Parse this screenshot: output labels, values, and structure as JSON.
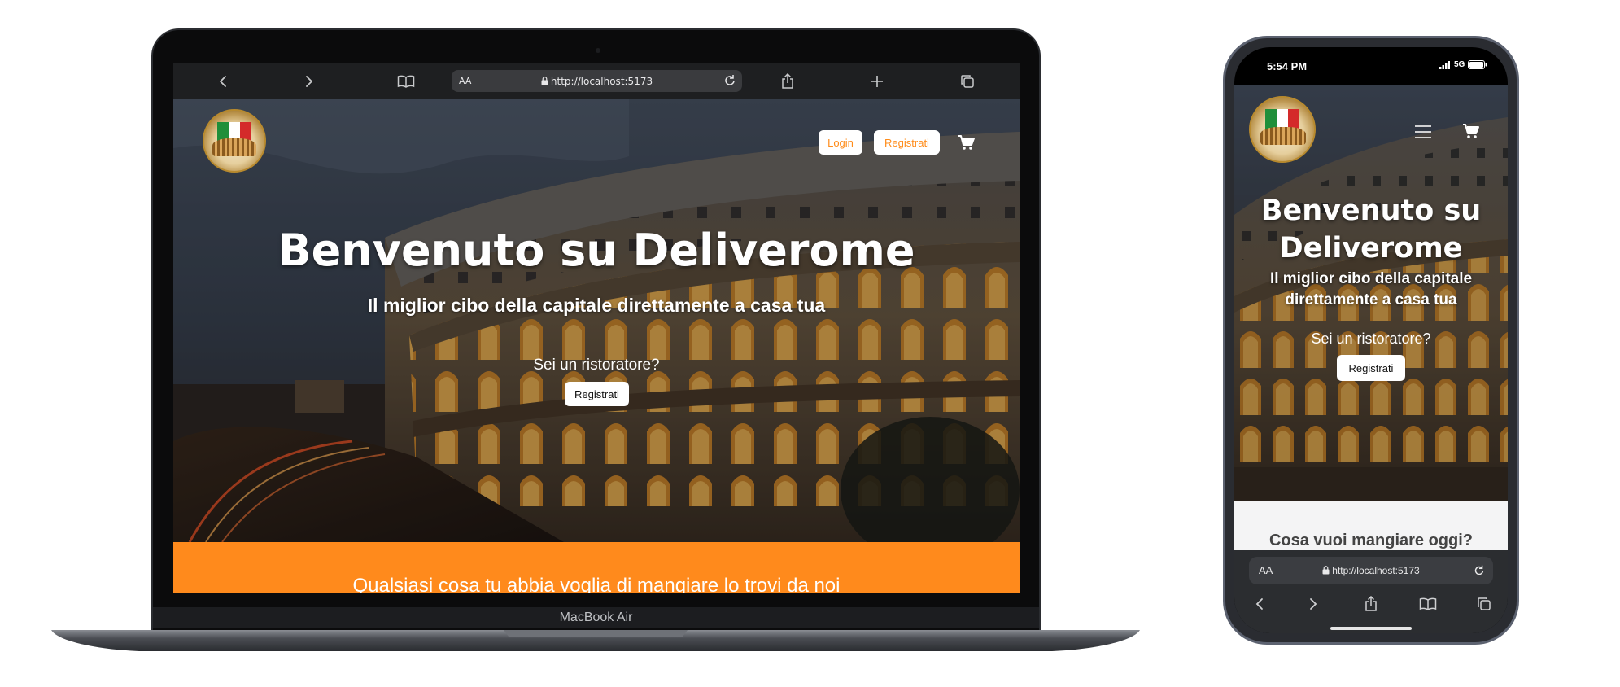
{
  "laptop": {
    "browser": {
      "url": "http://localhost:5173",
      "text_size_label": "AA"
    },
    "header": {
      "login_label": "Login",
      "register_label": "Registrati"
    },
    "hero": {
      "title": "Benvenuto su Deliverome",
      "subtitle": "Il miglior cibo della capitale direttamente a casa tua",
      "restaurateur_question": "Sei un ristoratore?",
      "restaurateur_button": "Registrati"
    },
    "band": {
      "text": "Qualsiasi cosa tu abbia voglia di mangiare lo trovi da noi"
    },
    "model_label": "MacBook Air"
  },
  "phone": {
    "status": {
      "time": "5:54 PM",
      "network": "5G"
    },
    "hero": {
      "title_line1": "Benvenuto su",
      "title_line2": "Deliverome",
      "subtitle_line1": "Il miglior cibo della capitale",
      "subtitle_line2": "direttamente a casa tua",
      "restaurateur_question": "Sei un ristoratore?",
      "restaurateur_button": "Registrati"
    },
    "section": {
      "heading": "Cosa vuoi mangiare oggi?"
    },
    "browser": {
      "url": "http://localhost:5173",
      "text_size_label": "AA"
    }
  },
  "colors": {
    "accent_orange": "#ff8a1c",
    "button_bg": "#ffffff",
    "dark_toolbar": "#1e1f21"
  },
  "icons": [
    "back-icon",
    "forward-icon",
    "bookmarks-icon",
    "lock-icon",
    "reload-icon",
    "share-icon",
    "new-tab-icon",
    "tabs-icon",
    "cart-icon",
    "hamburger-menu-icon"
  ]
}
